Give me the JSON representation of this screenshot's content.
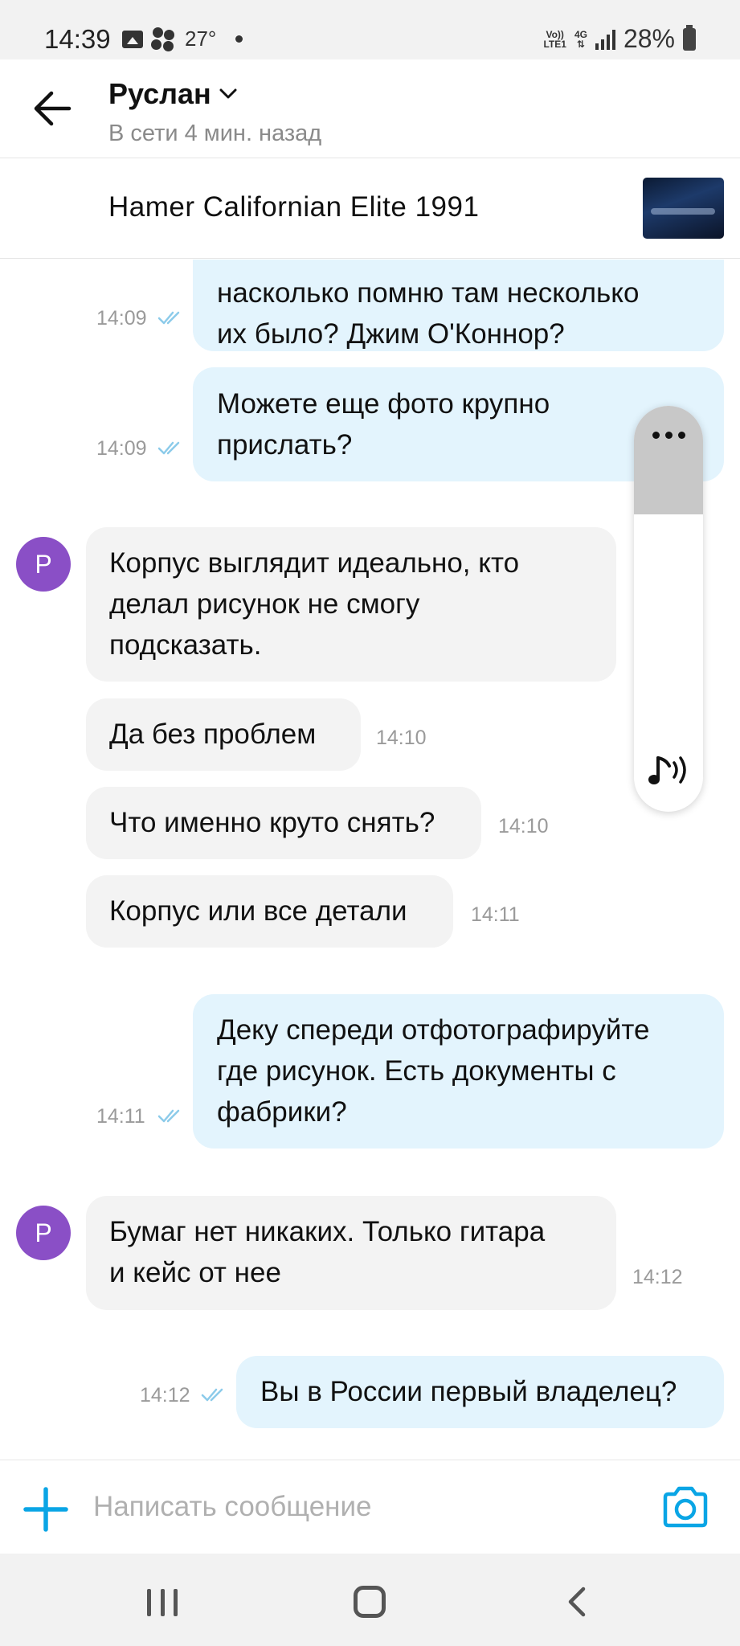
{
  "status_bar": {
    "time": "14:39",
    "temperature": "27°",
    "network_top": "Vo))",
    "network_bottom": "LTE1",
    "net_type": "4G",
    "battery": "28%"
  },
  "header": {
    "contact_name": "Руслан",
    "contact_status": "В сети 4 мин. назад"
  },
  "listing": {
    "title": "Hamer Californian Elite 1991"
  },
  "messages": [
    {
      "direction": "out",
      "lines": [
        "насколько помню там несколько",
        "их было? Джим О'Коннор?"
      ],
      "time": "14:09",
      "status": "read"
    },
    {
      "direction": "out",
      "lines": [
        "Можете еще фото крупно",
        "прислать?"
      ],
      "time": "14:09",
      "status": "read"
    },
    {
      "direction": "in",
      "avatar_letter": "Р",
      "lines": [
        "Корпус выглядит идеально, кто",
        "делал рисунок не смогу",
        "подсказать."
      ],
      "time": ""
    },
    {
      "direction": "in",
      "lines": [
        "Да без проблем"
      ],
      "time": "14:10"
    },
    {
      "direction": "in",
      "lines": [
        "Что именно круто снять?"
      ],
      "time": "14:10"
    },
    {
      "direction": "in",
      "lines": [
        "Корпус или все детали"
      ],
      "time": "14:11"
    },
    {
      "direction": "out",
      "lines": [
        "Деку спереди отфотографируйте",
        "где рисунок. Есть документы с",
        "фабрики?"
      ],
      "time": "14:11",
      "status": "read"
    },
    {
      "direction": "in",
      "avatar_letter": "Р",
      "lines": [
        "Бумаг нет никаких. Только гитара",
        "и кейс от нее"
      ],
      "time": "14:12"
    },
    {
      "direction": "out",
      "lines": [
        "Вы в России первый владелец?"
      ],
      "time": "14:12",
      "status": "read"
    }
  ],
  "volume": {
    "level_percent": 20
  },
  "composer": {
    "placeholder": "Написать сообщение"
  },
  "colors": {
    "accent": "#0aa5e5",
    "outgoing_bubble": "#e3f4fd",
    "incoming_bubble": "#f3f3f3",
    "avatar": "#8a4fc6",
    "read_ticks": "#8ccbea"
  }
}
